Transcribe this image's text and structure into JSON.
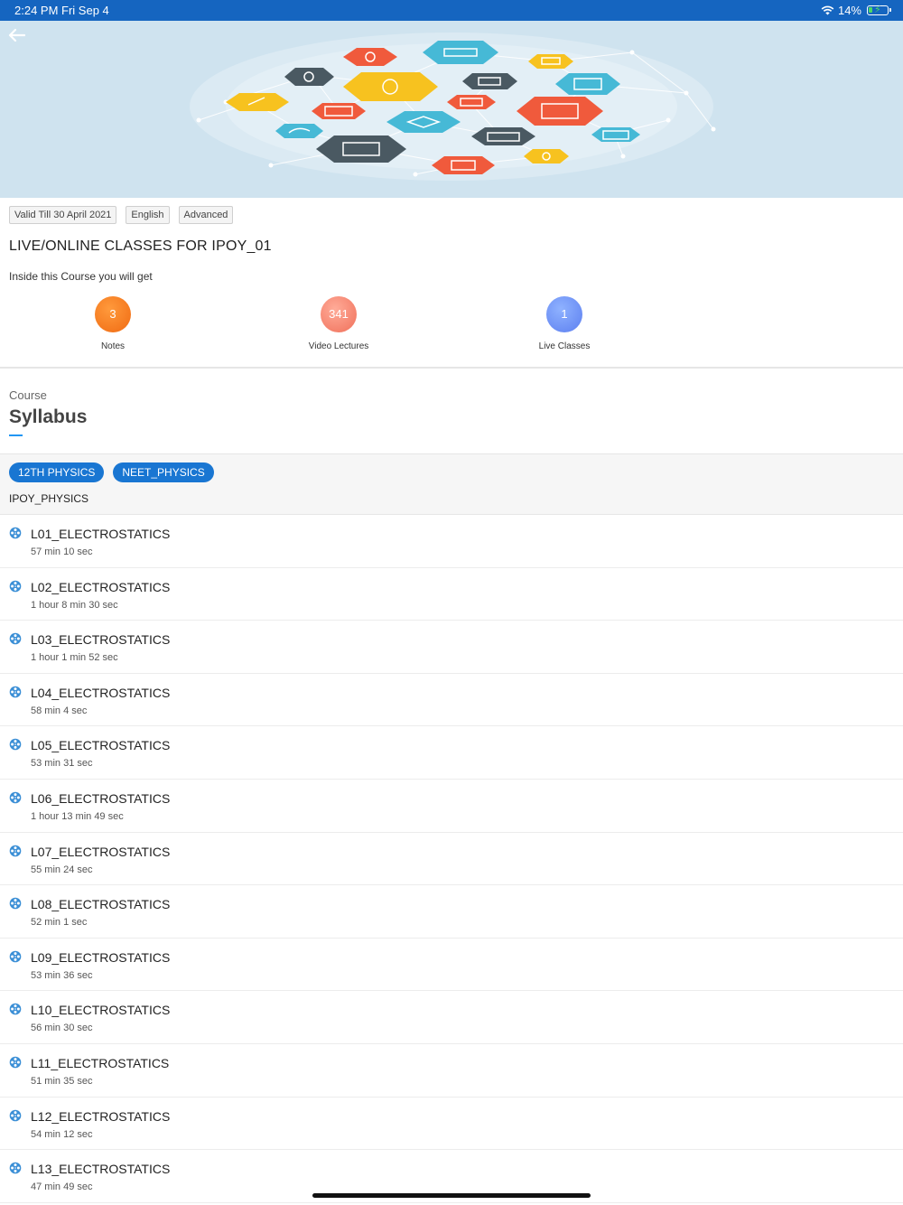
{
  "status_bar": {
    "time": "2:24 PM  Fri Sep 4",
    "battery": "14%"
  },
  "tags": [
    "Valid Till 30 April 2021",
    "English",
    "Advanced"
  ],
  "course_title": "LIVE/ONLINE CLASSES FOR IPOY_01",
  "inside_label": "Inside this Course you will get",
  "stats": [
    {
      "count": "3",
      "label": "Notes"
    },
    {
      "count": "341",
      "label": "Video Lectures"
    },
    {
      "count": "1",
      "label": "Live Classes"
    }
  ],
  "section": {
    "sub": "Course",
    "title": "Syllabus"
  },
  "chips": [
    "12TH PHYSICS",
    "NEET_PHYSICS"
  ],
  "filter_label": "IPOY_PHYSICS",
  "lessons": [
    {
      "name": "L01_ELECTROSTATICS",
      "duration": "57 min 10 sec"
    },
    {
      "name": "L02_ELECTROSTATICS",
      "duration": "1 hour 8 min 30 sec"
    },
    {
      "name": "L03_ELECTROSTATICS",
      "duration": "1 hour 1 min 52 sec"
    },
    {
      "name": "L04_ELECTROSTATICS",
      "duration": "58 min 4 sec"
    },
    {
      "name": "L05_ELECTROSTATICS",
      "duration": "53 min 31 sec"
    },
    {
      "name": "L06_ELECTROSTATICS",
      "duration": "1 hour 13 min 49 sec"
    },
    {
      "name": "L07_ELECTROSTATICS",
      "duration": "55 min 24 sec"
    },
    {
      "name": "L08_ELECTROSTATICS",
      "duration": "52 min 1 sec"
    },
    {
      "name": "L09_ELECTROSTATICS",
      "duration": "53 min 36 sec"
    },
    {
      "name": "L10_ELECTROSTATICS",
      "duration": "56 min 30 sec"
    },
    {
      "name": "L11_ELECTROSTATICS",
      "duration": "51 min 35 sec"
    },
    {
      "name": "L12_ELECTROSTATICS",
      "duration": "54 min 12 sec"
    },
    {
      "name": "L13_ELECTROSTATICS",
      "duration": "47 min 49 sec"
    }
  ],
  "colors": {
    "status_bar": "#1565c0",
    "banner_bg": "#cfe3ef",
    "chip": "#1976d2",
    "accent": "#2196f3",
    "reel_icon": "#3b8fd6"
  },
  "icons": {
    "back": "arrow-left-icon",
    "lesson": "film-reel-icon",
    "wifi": "wifi-icon",
    "battery": "battery-charging-icon"
  }
}
